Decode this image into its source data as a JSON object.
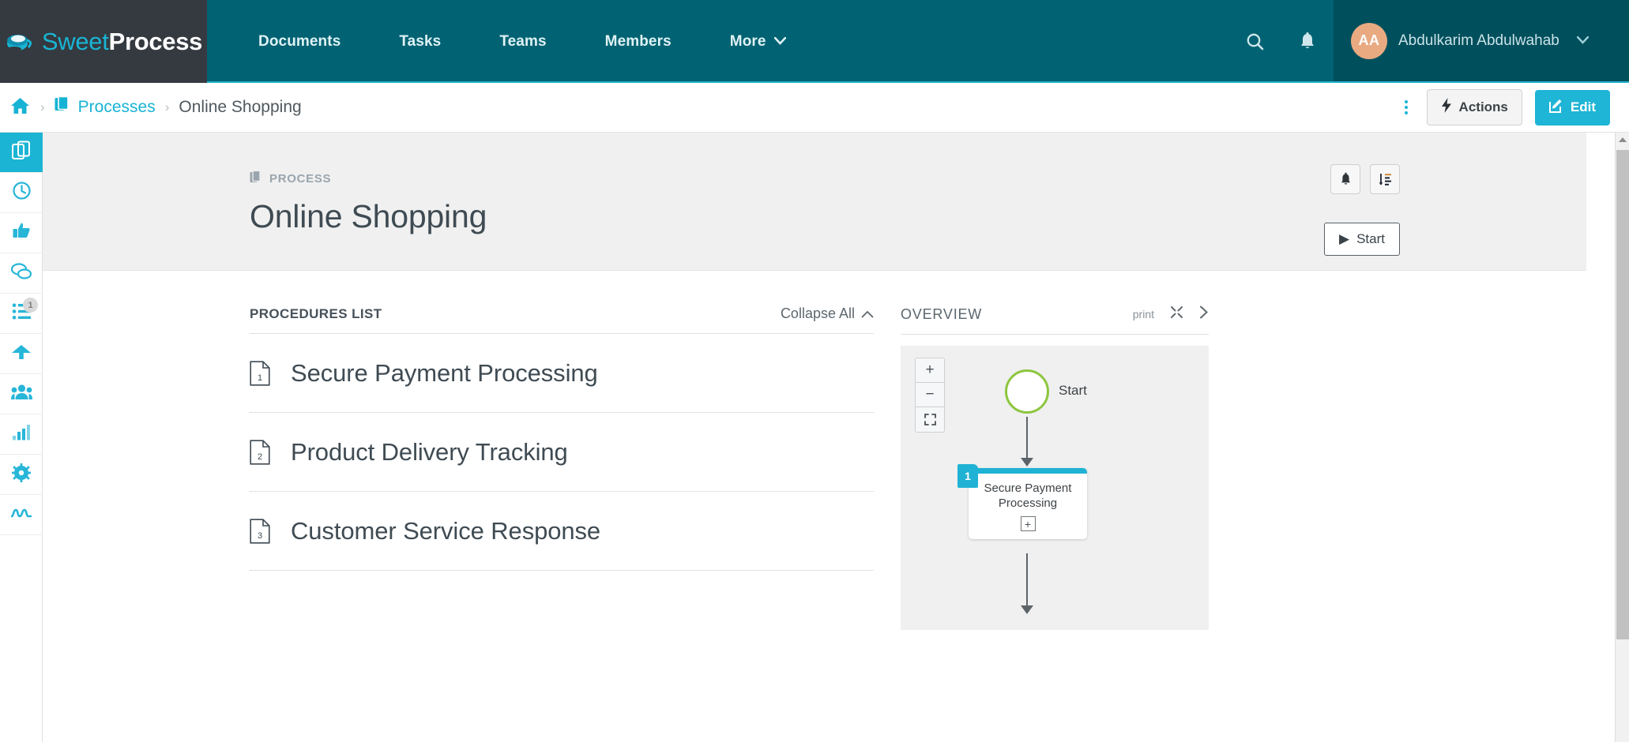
{
  "app": {
    "brand_sweet": "Sweet",
    "brand_process": "Process"
  },
  "topnav": {
    "items": [
      {
        "label": "Documents",
        "caret": false
      },
      {
        "label": "Tasks",
        "caret": false
      },
      {
        "label": "Teams",
        "caret": false
      },
      {
        "label": "Members",
        "caret": false
      },
      {
        "label": "More",
        "caret": true,
        "caret_glyph": "⌄"
      }
    ],
    "search_icon": "search-icon",
    "bell_icon": "bell-icon",
    "user": {
      "initials": "AA",
      "name": "Abdulkarim Abdulwahab",
      "caret": "⌄"
    }
  },
  "breadcrumb": {
    "home_glyph": "⌂",
    "separator": "›",
    "items": [
      {
        "label": "Processes",
        "type": "link"
      },
      {
        "label": "Online Shopping",
        "type": "current"
      }
    ],
    "kebab_label": "more-options",
    "actions_button": "Actions",
    "edit_button": "Edit"
  },
  "rail": {
    "items": [
      {
        "name": "documents",
        "active": true,
        "badge": null
      },
      {
        "name": "history",
        "active": false,
        "badge": null
      },
      {
        "name": "approvals",
        "active": false,
        "badge": null
      },
      {
        "name": "comments",
        "active": false,
        "badge": null
      },
      {
        "name": "tasks",
        "active": false,
        "badge": "1"
      },
      {
        "name": "uploads",
        "active": false,
        "badge": null
      },
      {
        "name": "teams",
        "active": false,
        "badge": null
      },
      {
        "name": "reports",
        "active": false,
        "badge": null
      },
      {
        "name": "settings",
        "active": false,
        "badge": null
      },
      {
        "name": "activity",
        "active": false,
        "badge": null
      }
    ]
  },
  "hero": {
    "kicker": "PROCESS",
    "title": "Online Shopping",
    "follow_icon": "bell-icon",
    "reorder_icon": "sort-icon",
    "start_button": "Start",
    "start_icon": "▶"
  },
  "procedures": {
    "section_title": "PROCEDURES LIST",
    "collapse_all": "Collapse All",
    "collapse_caret": "∧",
    "items": [
      {
        "number": "1",
        "title": "Secure Payment Processing"
      },
      {
        "number": "2",
        "title": "Product Delivery Tracking"
      },
      {
        "number": "3",
        "title": "Customer Service Response"
      }
    ]
  },
  "overview": {
    "section_title": "OVERVIEW",
    "print_label": "print",
    "expand_icon": "expand-icon",
    "next_icon": "chevron-right-icon",
    "zoom_in": "+",
    "zoom_out": "−",
    "zoom_fit": "⛶",
    "diagram": {
      "start_label": "Start",
      "nodes": [
        {
          "tag": "1",
          "title": "Secure Payment Processing",
          "expand": "+"
        }
      ]
    }
  },
  "colors": {
    "brand_dark": "#343a40",
    "nav_teal": "#006272",
    "nav_teal_dark": "#004f5c",
    "accent_cyan": "#1fb5d6",
    "green_start": "#8dc63f",
    "avatar": "#e9aa82"
  }
}
